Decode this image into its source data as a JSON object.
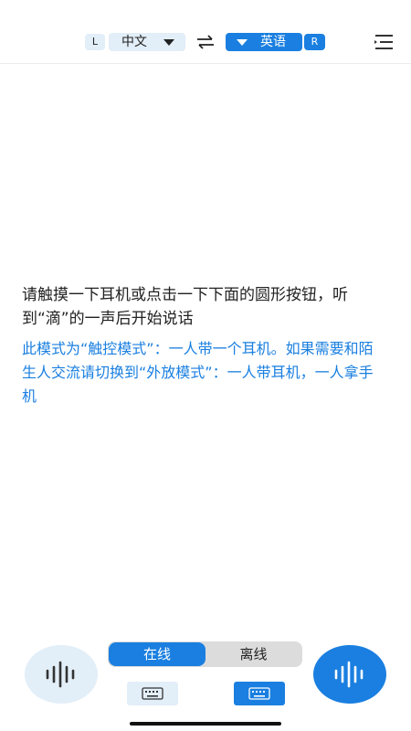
{
  "header": {
    "left_channel": "L",
    "source_language": "中文",
    "target_language": "英语",
    "right_channel": "R"
  },
  "main": {
    "prompt": "请触摸一下耳机或点击一下下面的圆形按钮，听到“滴”的一声后开始说话",
    "hint": "此模式为“触控模式”：一人带一个耳机。如果需要和陌生人交流请切换到“外放模式”：一人带耳机，一人拿手机"
  },
  "bottom": {
    "mode_online": "在线",
    "mode_offline": "离线",
    "selected_mode": "在线"
  },
  "colors": {
    "accent": "#1a7fe0",
    "light_accent": "#e2eef8",
    "hint_text": "#1a7fe0"
  },
  "icons": {
    "swap": "swap-arrows-icon",
    "menu": "menu-icon",
    "mic_left": "waveform-icon",
    "mic_right": "waveform-icon",
    "keyboard": "keyboard-icon"
  }
}
